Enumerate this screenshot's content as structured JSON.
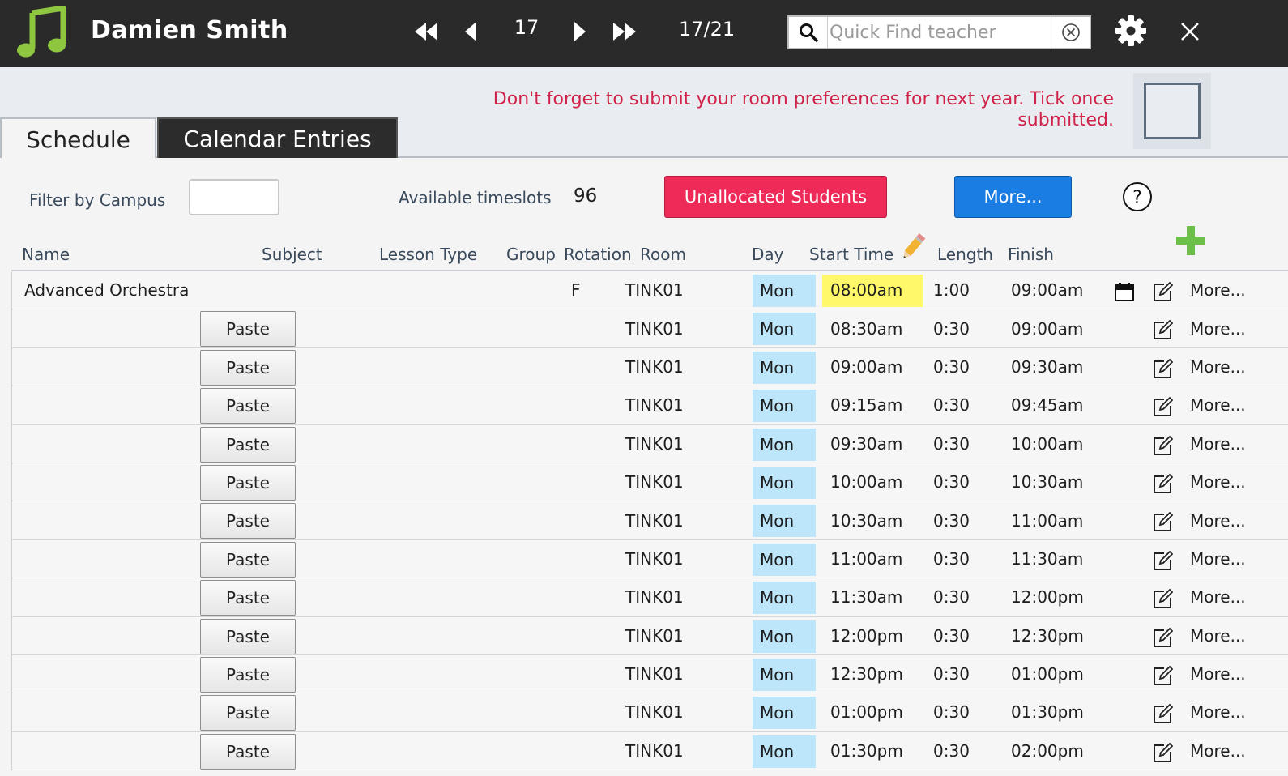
{
  "header": {
    "teacher_name": "Damien Smith",
    "page_current": "17",
    "page_count": "17/21",
    "search_placeholder": "Quick Find teacher",
    "icons": {
      "logo": "music-note-icon",
      "first": "skip-back-icon",
      "prev": "triangle-left-icon",
      "next": "triangle-right-icon",
      "last": "skip-forward-icon",
      "search": "magnifier-icon",
      "clear": "circle-x-icon",
      "settings": "gear-icon",
      "close": "x-icon"
    },
    "colors": {
      "bar": "#2a2a2a",
      "logo": "#8ec63f"
    }
  },
  "notice": {
    "text": "Don't forget to submit your room preferences for next year. Tick once submitted.",
    "color": "#d0234a"
  },
  "tabs": [
    {
      "label": "Schedule",
      "active": true
    },
    {
      "label": "Calendar Entries",
      "active": false
    }
  ],
  "toolbar": {
    "filter_label": "Filter by Campus",
    "filter_value": "",
    "timeslots_label": "Available timeslots",
    "timeslots_value": "96",
    "unallocated_label": "Unallocated Students",
    "more_label": "More...",
    "colors": {
      "unallocated": "#ee2b58",
      "more": "#1a7de3",
      "add": "#6cc04a"
    }
  },
  "columns": [
    "Name",
    "Subject",
    "Lesson Type",
    "Group",
    "Rotation",
    "Room",
    "Day",
    "Start Time",
    "Length",
    "Finish"
  ],
  "rows": [
    {
      "name": "Advanced Orchestra",
      "paste": "",
      "rotation": "F",
      "room": "TINK01",
      "day": "Mon",
      "start": "08:00am",
      "length": "1:00",
      "finish": "09:00am",
      "more": "More...",
      "highlight": true,
      "calendar": true
    },
    {
      "name": "",
      "paste": "Paste",
      "rotation": "",
      "room": "TINK01",
      "day": "Mon",
      "start": "08:30am",
      "length": "0:30",
      "finish": "09:00am",
      "more": "More..."
    },
    {
      "name": "",
      "paste": "Paste",
      "rotation": "",
      "room": "TINK01",
      "day": "Mon",
      "start": "09:00am",
      "length": "0:30",
      "finish": "09:30am",
      "more": "More..."
    },
    {
      "name": "",
      "paste": "Paste",
      "rotation": "",
      "room": "TINK01",
      "day": "Mon",
      "start": "09:15am",
      "length": "0:30",
      "finish": "09:45am",
      "more": "More..."
    },
    {
      "name": "",
      "paste": "Paste",
      "rotation": "",
      "room": "TINK01",
      "day": "Mon",
      "start": "09:30am",
      "length": "0:30",
      "finish": "10:00am",
      "more": "More..."
    },
    {
      "name": "",
      "paste": "Paste",
      "rotation": "",
      "room": "TINK01",
      "day": "Mon",
      "start": "10:00am",
      "length": "0:30",
      "finish": "10:30am",
      "more": "More..."
    },
    {
      "name": "",
      "paste": "Paste",
      "rotation": "",
      "room": "TINK01",
      "day": "Mon",
      "start": "10:30am",
      "length": "0:30",
      "finish": "11:00am",
      "more": "More..."
    },
    {
      "name": "",
      "paste": "Paste",
      "rotation": "",
      "room": "TINK01",
      "day": "Mon",
      "start": "11:00am",
      "length": "0:30",
      "finish": "11:30am",
      "more": "More..."
    },
    {
      "name": "",
      "paste": "Paste",
      "rotation": "",
      "room": "TINK01",
      "day": "Mon",
      "start": "11:30am",
      "length": "0:30",
      "finish": "12:00pm",
      "more": "More..."
    },
    {
      "name": "",
      "paste": "Paste",
      "rotation": "",
      "room": "TINK01",
      "day": "Mon",
      "start": "12:00pm",
      "length": "0:30",
      "finish": "12:30pm",
      "more": "More..."
    },
    {
      "name": "",
      "paste": "Paste",
      "rotation": "",
      "room": "TINK01",
      "day": "Mon",
      "start": "12:30pm",
      "length": "0:30",
      "finish": "01:00pm",
      "more": "More..."
    },
    {
      "name": "",
      "paste": "Paste",
      "rotation": "",
      "room": "TINK01",
      "day": "Mon",
      "start": "01:00pm",
      "length": "0:30",
      "finish": "01:30pm",
      "more": "More..."
    },
    {
      "name": "",
      "paste": "Paste",
      "rotation": "",
      "room": "TINK01",
      "day": "Mon",
      "start": "01:30pm",
      "length": "0:30",
      "finish": "02:00pm",
      "more": "More..."
    }
  ]
}
